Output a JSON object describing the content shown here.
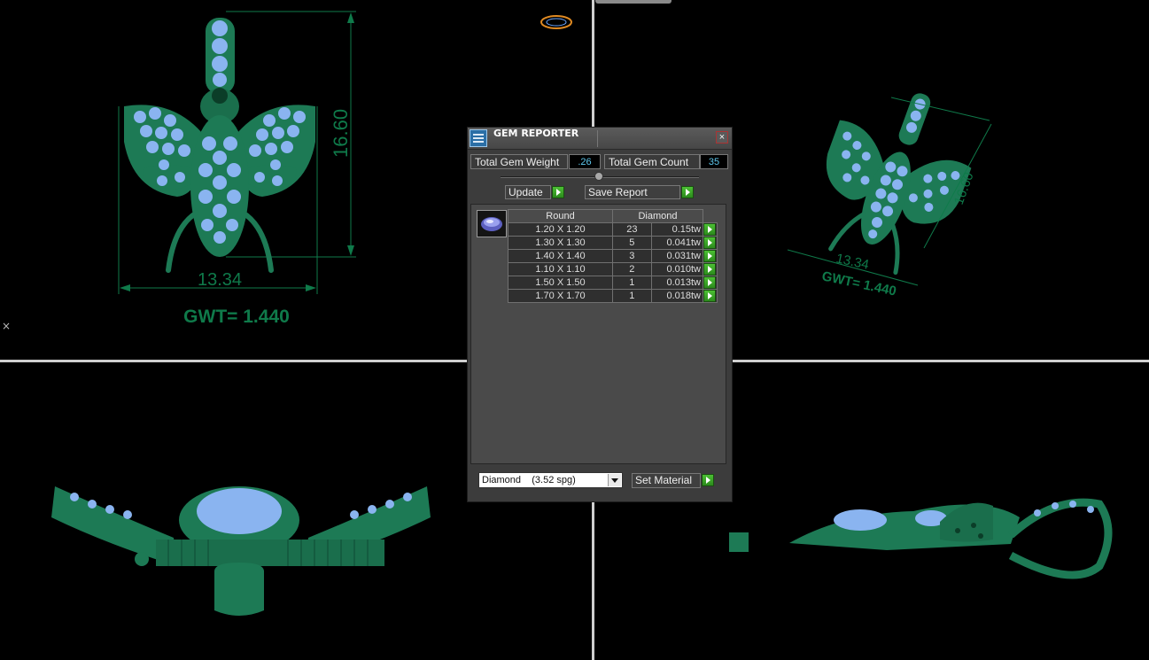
{
  "viewports": {
    "front": {
      "width_dim": "13.34",
      "height_dim": "16.60",
      "gwt": "GWT= 1.440"
    },
    "perspective": {
      "width_dim": "13.34",
      "height_dim": "16.60",
      "gwt": "GWT= 1.440"
    }
  },
  "close_mark": "×",
  "dialog": {
    "title": "GEM REPORTER",
    "close": "×",
    "total_weight_label": "Total Gem Weight",
    "total_weight_value": ".26",
    "total_count_label": "Total Gem Count",
    "total_count_value": "35",
    "update_label": "Update",
    "save_label": "Save Report",
    "table": {
      "headers": [
        "Round",
        "Diamond"
      ],
      "rows": [
        {
          "size": "1.20 X 1.20",
          "count": "23",
          "weight": "0.15tw"
        },
        {
          "size": "1.30 X 1.30",
          "count": "5",
          "weight": "0.041tw"
        },
        {
          "size": "1.40 X 1.40",
          "count": "3",
          "weight": "0.031tw"
        },
        {
          "size": "1.10 X 1.10",
          "count": "2",
          "weight": "0.010tw"
        },
        {
          "size": "1.50 X 1.50",
          "count": "1",
          "weight": "0.013tw"
        },
        {
          "size": "1.70 X 1.70",
          "count": "1",
          "weight": "0.018tw"
        }
      ]
    },
    "material_select": "Diamond    (3.52 spg)",
    "set_material_label": "Set Material"
  },
  "icons": [
    "gem-thumbnail-icon",
    "play-arrow-icon",
    "dropdown-arrow-icon",
    "close-icon"
  ],
  "colors": {
    "metal": "#1d7a55",
    "gem": "#8ab4f0",
    "dimension": "#0f7a4a",
    "viewport_divider": "#cfcfcf"
  }
}
